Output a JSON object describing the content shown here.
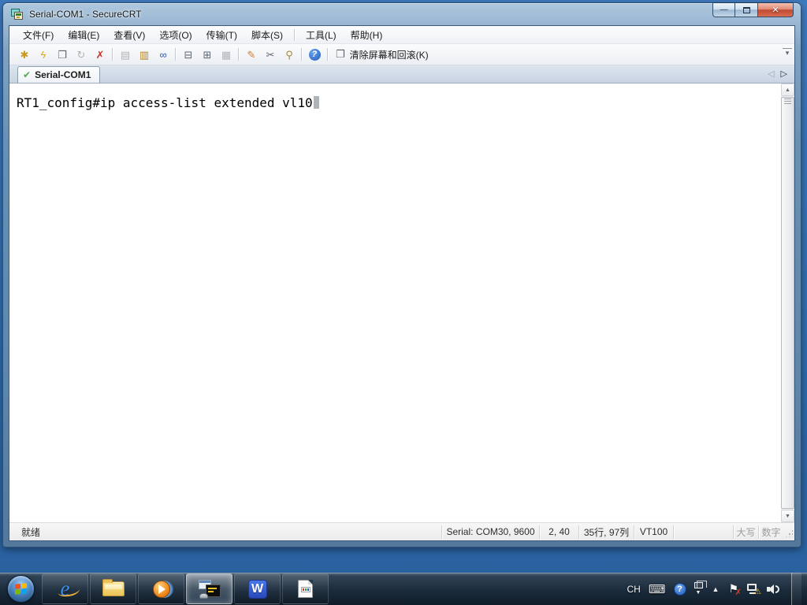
{
  "window": {
    "title": "Serial-COM1 - SecureCRT",
    "minimize_glyph": "—",
    "close_glyph": "✕"
  },
  "menu": {
    "left": [
      {
        "name": "menu-file",
        "label": "文件(F)"
      },
      {
        "name": "menu-edit",
        "label": "编辑(E)"
      },
      {
        "name": "menu-view",
        "label": "查看(V)"
      },
      {
        "name": "menu-options",
        "label": "选项(O)"
      },
      {
        "name": "menu-transfer",
        "label": "传输(T)"
      },
      {
        "name": "menu-script",
        "label": "脚本(S)"
      }
    ],
    "right": [
      {
        "name": "menu-tools",
        "label": "工具(L)"
      },
      {
        "name": "menu-help",
        "label": "帮助(H)"
      }
    ]
  },
  "toolbar": {
    "buttons": [
      {
        "name": "connect-icon",
        "glyph": "✱",
        "color": "#c89a22",
        "cls": ""
      },
      {
        "name": "quick-connect-icon",
        "glyph": "ϟ",
        "color": "#d9a626",
        "cls": ""
      },
      {
        "name": "connect-in-tab-icon",
        "glyph": "❐",
        "color": "#5a6570",
        "cls": ""
      },
      {
        "name": "reconnect-icon",
        "glyph": "↻",
        "color": "#9aa0a6",
        "cls": "dim"
      },
      {
        "name": "disconnect-icon",
        "glyph": "✗",
        "color": "#c23527",
        "cls": ""
      },
      {
        "name": "copy-icon",
        "glyph": "▤",
        "color": "#9aa0a6",
        "cls": "dim sep"
      },
      {
        "name": "paste-icon",
        "glyph": "▥",
        "color": "#b5832a",
        "cls": ""
      },
      {
        "name": "find-icon",
        "glyph": "∞",
        "color": "#2a59b0",
        "cls": ""
      },
      {
        "name": "print-preview-icon",
        "glyph": "⊟",
        "color": "#5a6570",
        "cls": "sep"
      },
      {
        "name": "print-setup-icon",
        "glyph": "⊞",
        "color": "#5a6570",
        "cls": ""
      },
      {
        "name": "print-icon",
        "glyph": "▦",
        "color": "#9aa0a6",
        "cls": "dim"
      },
      {
        "name": "session-options-icon",
        "glyph": "✎",
        "color": "#cf7a2a",
        "cls": "sep"
      },
      {
        "name": "global-options-icon",
        "glyph": "✂",
        "color": "#5a6570",
        "cls": ""
      },
      {
        "name": "keymap-icon",
        "glyph": "⚲",
        "color": "#a3893c",
        "cls": ""
      },
      {
        "name": "help-icon",
        "glyph": "?",
        "color": "#ffffff",
        "cls": "sep help"
      }
    ],
    "clear_glyph": "❐",
    "clear_label": "清除屏幕和回滚(K)",
    "overflow_glyph": "▾"
  },
  "tabbar": {
    "tab_label": "Serial-COM1",
    "check_glyph": "✔",
    "scroll_left_glyph": "◁",
    "scroll_right_glyph": "▷"
  },
  "terminal": {
    "line1": "RT1_config#ip access-list extended vl10"
  },
  "statusbar": {
    "ready": "就绪",
    "serial": "Serial: COM30, 9600",
    "cursor_pos": "2, 40",
    "screen_size": "35行, 97列",
    "emulation": "VT100",
    "caps": "大写",
    "num": "数字"
  },
  "taskbar": {
    "ie_glyph": "e",
    "wps_glyph": "W",
    "tray": {
      "lang": "CH",
      "keyboard_glyph": "⌨",
      "help_glyph": "?",
      "langbar_arrow_glyph": "▼",
      "hidden_icons_glyph": "▲",
      "flag_glyph": "⚑",
      "flag_error_glyph": "✗",
      "warning_glyph": "⚠"
    }
  }
}
